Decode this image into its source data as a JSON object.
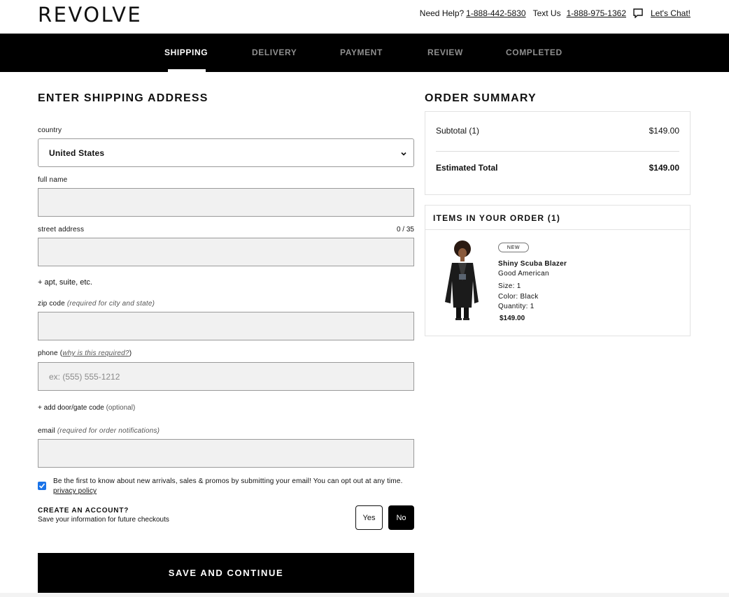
{
  "header": {
    "logo": "REVOLVE",
    "need_help": "Need Help?",
    "phone": "1-888-442-5830",
    "text_us": "Text Us",
    "text_number": "1-888-975-1362",
    "chat": "Let's Chat!",
    "chat_icon": "chat-bubble-icon"
  },
  "steps": [
    {
      "label": "SHIPPING",
      "active": true
    },
    {
      "label": "DELIVERY",
      "active": false
    },
    {
      "label": "PAYMENT",
      "active": false
    },
    {
      "label": "REVIEW",
      "active": false
    },
    {
      "label": "COMPLETED",
      "active": false
    }
  ],
  "form": {
    "title": "ENTER SHIPPING ADDRESS",
    "country_label": "country",
    "country_value": "United States",
    "full_name_label": "full name",
    "full_name_value": "",
    "street_label": "street address",
    "street_counter": "0 / 35",
    "street_value": "",
    "apt_link": "+ apt, suite, etc.",
    "zip_label": "zip code",
    "zip_note": "(required for city and state)",
    "zip_value": "",
    "phone_label": "phone (",
    "phone_why": "why is this required?",
    "phone_close": ")",
    "phone_placeholder": "ex: (555) 555-1212",
    "door_link": "+ add door/gate code",
    "door_optional": "(optional)",
    "email_label": "email",
    "email_note": "(required for order notifications)",
    "email_value": "",
    "promo_checked": true,
    "promo_text": "Be the first to know about new arrivals, sales & promos by submitting your email! You can opt out at any time.",
    "privacy_link": "privacy policy",
    "create_title": "CREATE AN ACCOUNT?",
    "create_sub": "Save your information for future checkouts",
    "yes_label": "Yes",
    "no_label": "No",
    "save_label": "SAVE AND CONTINUE"
  },
  "summary": {
    "title": "ORDER SUMMARY",
    "subtotal_label": "Subtotal (1)",
    "subtotal_value": "$149.00",
    "total_label": "Estimated Total",
    "total_value": "$149.00"
  },
  "items": {
    "title": "ITEMS IN YOUR ORDER (1)",
    "product": {
      "badge": "NEW",
      "name": "Shiny Scuba Blazer",
      "brand": "Good American",
      "size": "Size:  1",
      "color": "Color:  Black",
      "quantity": "Quantity:  1",
      "price": "$149.00"
    }
  },
  "colors": {
    "accent": "#000000",
    "checkbox": "#1a73e8",
    "field_bg": "#f1f1f1"
  }
}
